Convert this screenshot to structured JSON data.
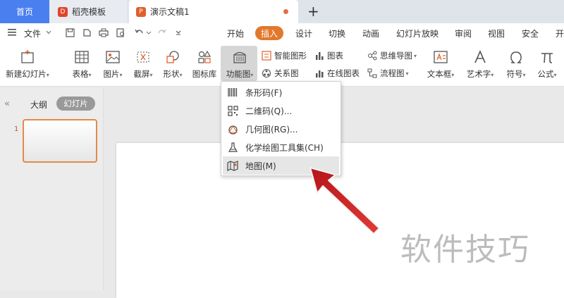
{
  "tabs": {
    "home": "首页",
    "template": "稻壳模板",
    "document": "演示文稿1",
    "template_logo": "D",
    "document_logo": "P",
    "new_tab": "+"
  },
  "menu": {
    "file": "文件",
    "items": [
      "开始",
      "插入",
      "设计",
      "切换",
      "动画",
      "幻灯片放映",
      "审阅",
      "视图",
      "安全",
      "开"
    ]
  },
  "ribbon": {
    "new_slide": "新建幻灯片",
    "table": "表格",
    "picture": "图片",
    "screenshot": "截屏",
    "shape": "形状",
    "icon_lib": "图标库",
    "function_chart": "功能图",
    "smart_shape": "智能图形",
    "chart": "图表",
    "mind_map": "思维导图",
    "relation": "关系图",
    "online_chart": "在线图表",
    "flowchart": "流程图",
    "textbox": "文本框",
    "art_text": "艺术字",
    "symbol": "符号",
    "formula": "公式"
  },
  "leftpanel": {
    "outline": "大纲",
    "slides": "幻灯片",
    "slide_number": "1"
  },
  "dropdown": {
    "items": [
      {
        "label": "条形码(F)",
        "icon": "barcode-icon"
      },
      {
        "label": "二维码(Q)...",
        "icon": "qrcode-icon"
      },
      {
        "label": "几何图(RG)...",
        "icon": "geometry-icon"
      },
      {
        "label": "化学绘图工具集(CH)",
        "icon": "flask-icon"
      },
      {
        "label": "地图(M)",
        "icon": "map-icon"
      }
    ],
    "highlighted_index": 4
  },
  "watermark": "软件技巧",
  "colors": {
    "home_tab": "#4a7ff0",
    "insert_tab": "#e2782c",
    "slide_border": "#e38a4b",
    "arrow": "#d9262a"
  }
}
